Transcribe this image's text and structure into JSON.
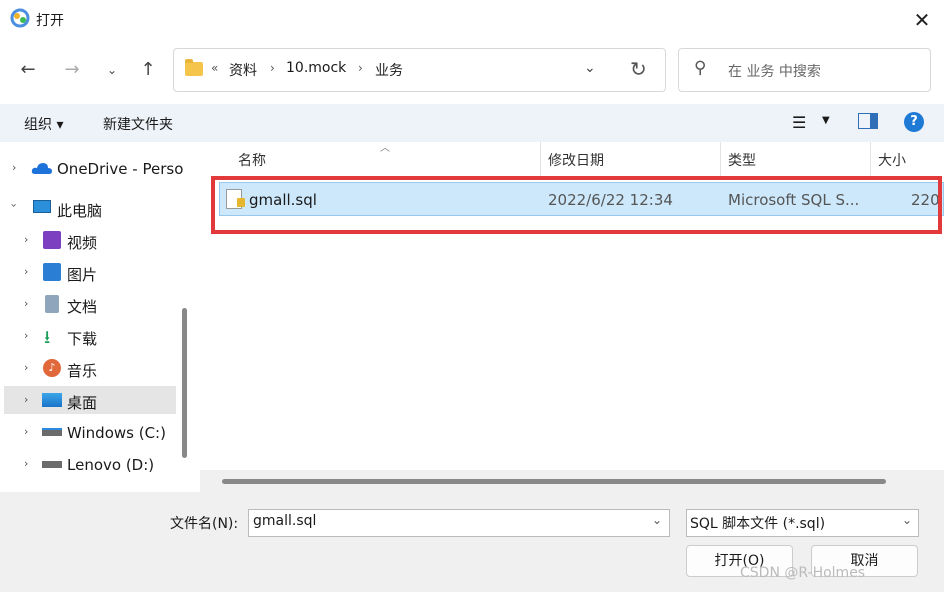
{
  "window": {
    "title": "打开"
  },
  "address": {
    "overflow": "«",
    "crumbs": [
      "资料",
      "10.mock",
      "业务"
    ],
    "separator": "›"
  },
  "search": {
    "placeholder": "在 业务 中搜索"
  },
  "toolbar": {
    "organize": "组织 ▾",
    "new_folder": "新建文件夹",
    "help": "?"
  },
  "nav_tree": {
    "onedrive": "OneDrive - Perso",
    "this_pc": "此电脑",
    "videos": "视频",
    "pictures": "图片",
    "documents": "文档",
    "downloads": "下载",
    "music": "音乐",
    "desktop": "桌面",
    "windows_c": "Windows (C:)",
    "lenovo_d": "Lenovo (D:)"
  },
  "columns": {
    "name": "名称",
    "modified": "修改日期",
    "type": "类型",
    "size": "大小"
  },
  "files": [
    {
      "name": "gmall.sql",
      "modified": "2022/6/22 12:34",
      "type": "Microsoft SQL S...",
      "size": "220"
    }
  ],
  "bottom": {
    "filename_label": "文件名(N):",
    "filename_value": "gmall.sql",
    "filetype_value": "SQL 脚本文件 (*.sql)",
    "open": "打开(O)",
    "cancel": "取消"
  },
  "watermark": "CSDN @R-Holmes",
  "colors": {
    "accent": "#1f7ad6",
    "selection": "#cde8fb",
    "highlight_box": "#e23a3a",
    "folder": "#f5c54b"
  }
}
